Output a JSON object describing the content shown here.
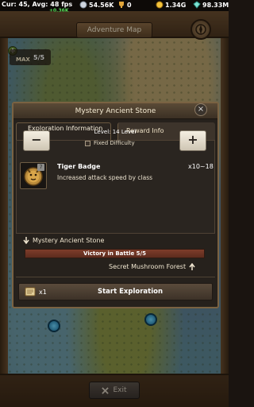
{
  "status_bar": {
    "fps_text": "Cur: 45, Avg: 48 fps",
    "fps_sub": "+0.36K",
    "silver": "54.56K",
    "trophy": "0",
    "gold": "1.34G",
    "gems": "98.33M"
  },
  "map": {
    "title": "Adventure Map",
    "max_label": "MAX",
    "max_value": "5/5",
    "exit_label": "Exit"
  },
  "dialog": {
    "title": "Mystery Ancient Stone",
    "tabs": [
      {
        "label": "Exploration Information",
        "active": true
      },
      {
        "label": "Reward Info",
        "active": false
      }
    ],
    "level_text": "Level: 14 Level",
    "fixed_difficulty_label": "Fixed Difficulty",
    "fixed_difficulty_checked": false,
    "minus_label": "−",
    "plus_label": "+",
    "reward": {
      "name": "Tiger Badge",
      "description": "Increased attack speed by class",
      "quantity": "x10~18",
      "grade": "7"
    },
    "from_location": "Mystery Ancient Stone",
    "progress_text": "Victory in Battle 5/5",
    "progress_fraction": 1.0,
    "to_location": "Secret Mushroom Forest",
    "ticket_count": "x1",
    "start_label": "Start Exploration"
  }
}
